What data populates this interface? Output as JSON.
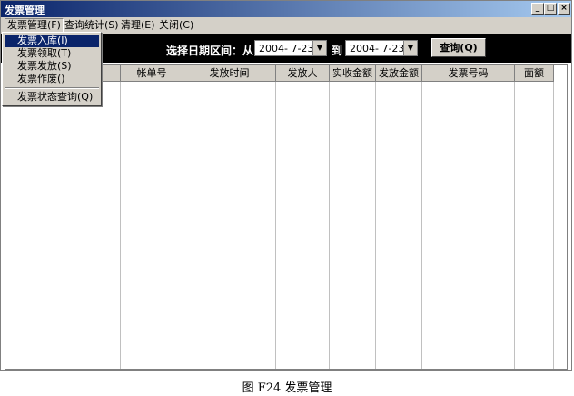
{
  "window": {
    "title": "发票管理"
  },
  "menubar": {
    "items": [
      "发票管理(F)",
      "查询统计(S)",
      "清理(E)",
      "关闭(C)"
    ]
  },
  "dropdown": {
    "items": [
      "发票入库(I)",
      "发票领取(T)",
      "发票发放(S)",
      "发票作废()",
      "发票状态查询(Q)"
    ]
  },
  "toolbar": {
    "range_label": "选择日期区间：从",
    "from_date": "2004- 7-23",
    "to_label": "到",
    "to_date": "2004- 7-23",
    "query_button": "查询(Q)"
  },
  "table": {
    "columns": [
      "",
      "",
      "帐单号",
      "发放时间",
      "发放人",
      "实收金额",
      "发放金额",
      "发票号码",
      "面额"
    ]
  },
  "caption": "图 F24  发票管理"
}
